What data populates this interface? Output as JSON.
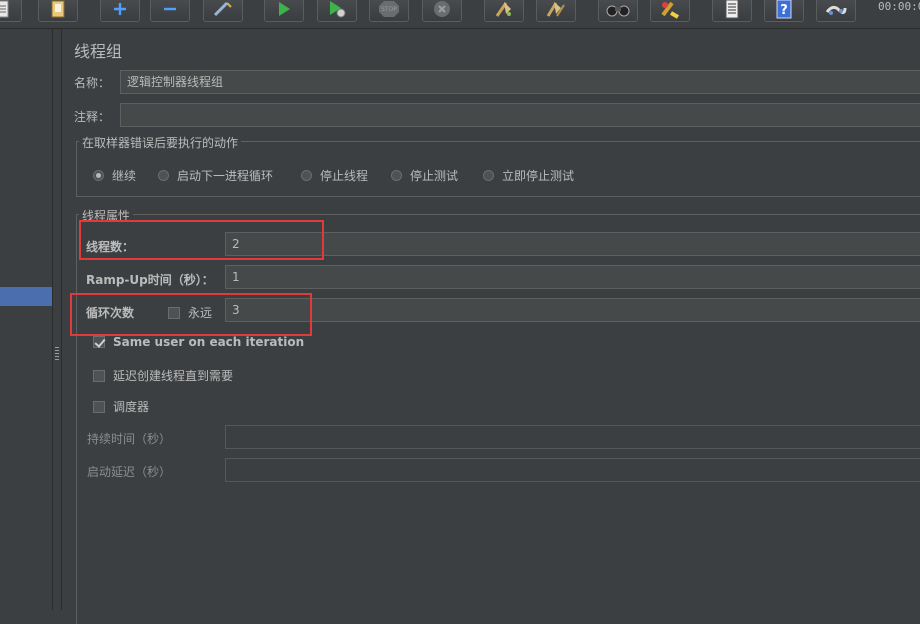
{
  "toolbar": {
    "timer": "00:00:0",
    "icons": [
      "template-icon",
      "templates-icon",
      "expand-icon",
      "collapse-icon",
      "toggle-icon",
      "start-icon",
      "start-no-pause-icon",
      "stop-icon",
      "shutdown-icon",
      "clear-icon",
      "clear-all-icon",
      "search-icon",
      "reset-search-icon",
      "function-helper-icon",
      "help-icon",
      "remote-icon"
    ]
  },
  "panel": {
    "title": "线程组",
    "name_label": "名称：",
    "name_value": "逻辑控制器线程组",
    "comment_label": "注释：",
    "comment_value": ""
  },
  "error_action": {
    "legend": "在取样器错误后要执行的动作",
    "options": [
      "继续",
      "启动下一进程循环",
      "停止线程",
      "停止测试",
      "立即停止测试"
    ],
    "selected": "继续"
  },
  "thread_props": {
    "legend": "线程属性",
    "threads_label": "线程数：",
    "threads_value": "2",
    "rampup_label": "Ramp-Up时间（秒）：",
    "rampup_value": "1",
    "loop_label": "循环次数",
    "forever_label": "永远",
    "forever_checked": false,
    "loop_value": "3",
    "same_user_label": "Same user on each iteration",
    "same_user_checked": true,
    "delay_label": "延迟创建线程直到需要",
    "delay_checked": false,
    "scheduler_label": "调度器",
    "scheduler_checked": false,
    "duration_label": "持续时间（秒）",
    "duration_value": "",
    "startup_delay_label": "启动延迟（秒）",
    "startup_delay_value": ""
  },
  "colors": {
    "background": "#3c3f41",
    "field": "#45494a",
    "highlight": "#e03a3a",
    "selection": "#4b6eaf"
  }
}
